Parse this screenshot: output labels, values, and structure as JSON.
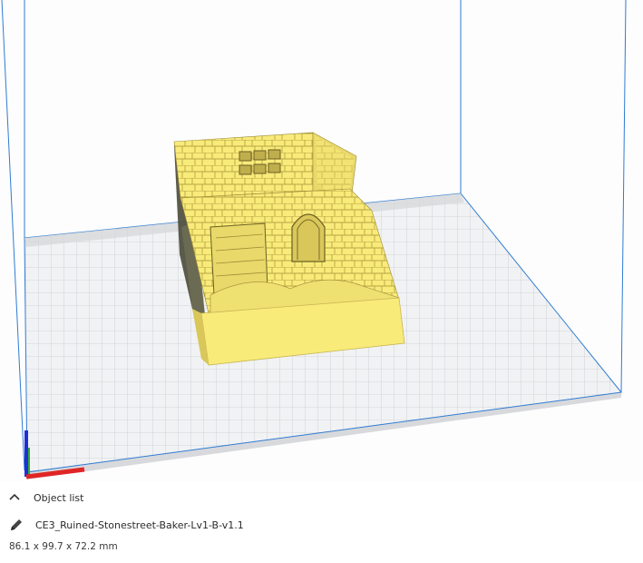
{
  "viewport": {
    "model_color": "#F8EB7A",
    "build_plate_color": "#F1F2F4",
    "volume_edge_color": "#2F7CD4",
    "axis_colors": {
      "x": "#E02525",
      "y": "#2EAA2E",
      "z": "#1E2FD8"
    }
  },
  "object_list": {
    "label": "Object list",
    "icon": "chevron-up-icon"
  },
  "selected_object": {
    "icon": "pencil-icon",
    "name": "CE3_Ruined-Stonestreet-Baker-Lv1-B-v1.1",
    "dimensions": "86.1 x 99.7 x 72.2 mm"
  }
}
